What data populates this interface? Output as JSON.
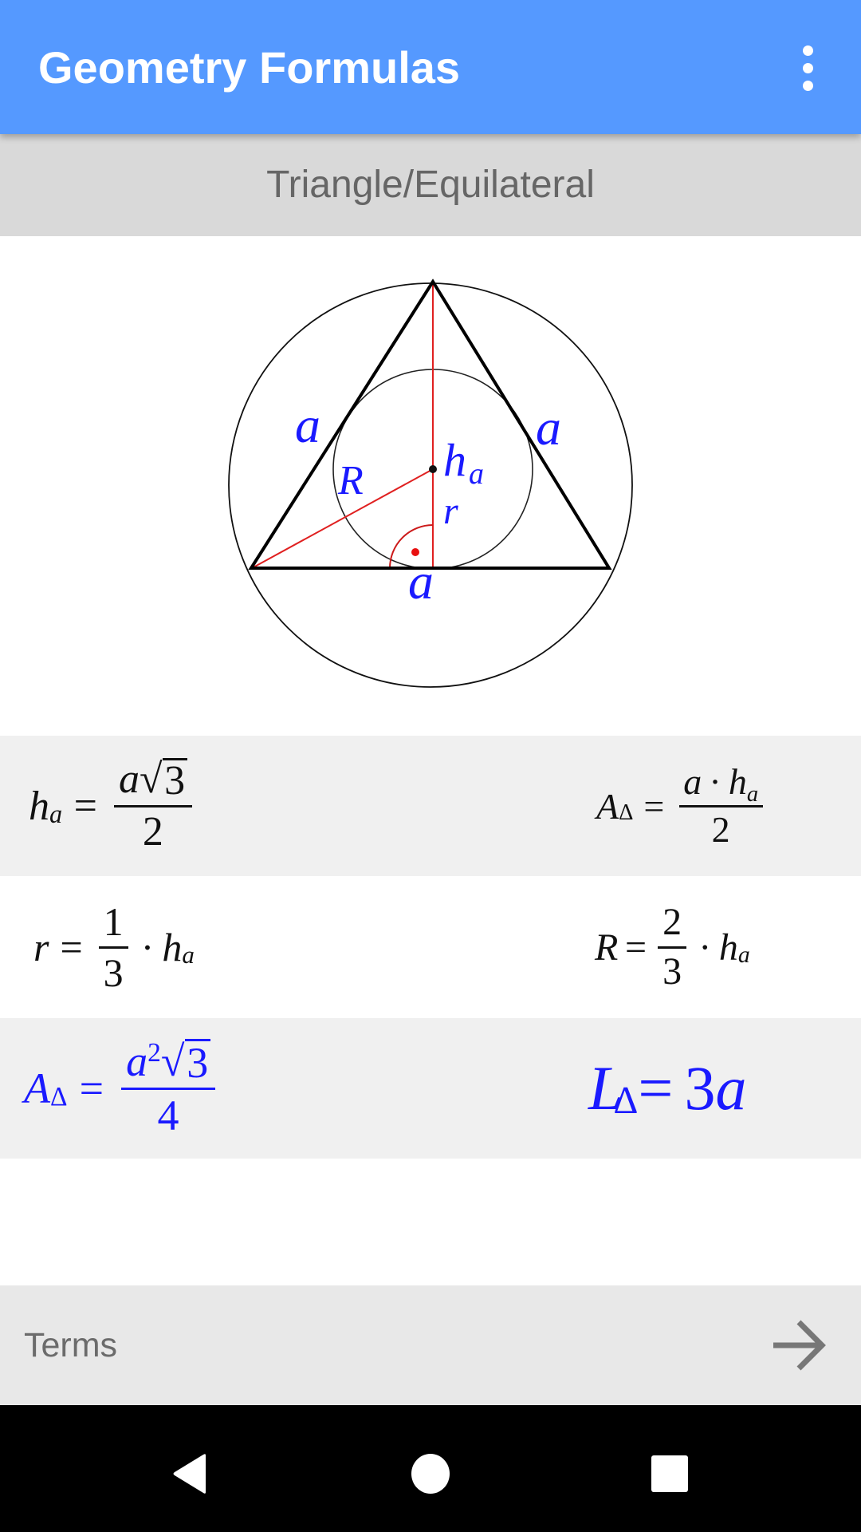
{
  "app_bar": {
    "title": "Geometry Formulas",
    "overflow_icon": "more-vert-icon",
    "color": "#5599ff"
  },
  "subtitle": "Triangle/Equilateral",
  "diagram": {
    "labels": {
      "side_left": "a",
      "side_right": "a",
      "side_bottom": "a",
      "height": "h",
      "height_sub": "a",
      "circumradius": "R",
      "inradius": "r"
    },
    "label_color": "#1a1aff",
    "construction_color": "#e02020"
  },
  "formulas": {
    "height": {
      "lhs": "h",
      "lhs_sub": "a",
      "eq": "=",
      "num_a": "a",
      "num_root": "3",
      "den": "2"
    },
    "area_by_height": {
      "lhs": "A",
      "lhs_sub": "Δ",
      "eq": "=",
      "num_a": "a",
      "num_dot": "·",
      "num_h": "h",
      "num_h_sub": "a",
      "den": "2"
    },
    "inradius": {
      "lhs": "r",
      "eq": "=",
      "num": "1",
      "den": "3",
      "dot": "·",
      "h": "h",
      "h_sub": "a"
    },
    "circumradius": {
      "lhs": "R",
      "eq": "=",
      "num": "2",
      "den": "3",
      "dot": "·",
      "h": "h",
      "h_sub": "a"
    },
    "area": {
      "lhs": "A",
      "lhs_sub": "Δ",
      "eq": "=",
      "num_a": "a",
      "num_exp": "2",
      "num_root": "3",
      "den": "4"
    },
    "perimeter": {
      "lhs": "L",
      "lhs_sub": "Δ",
      "eq": "=",
      "rhs_coef": "3",
      "rhs_var": "a"
    }
  },
  "highlight_color": "#1a1aff",
  "footer": {
    "terms_label": "Terms",
    "arrow_icon": "arrow-right-icon"
  },
  "nav_bar": {
    "back_icon": "back-icon",
    "home_icon": "home-icon",
    "recents_icon": "recents-icon"
  }
}
